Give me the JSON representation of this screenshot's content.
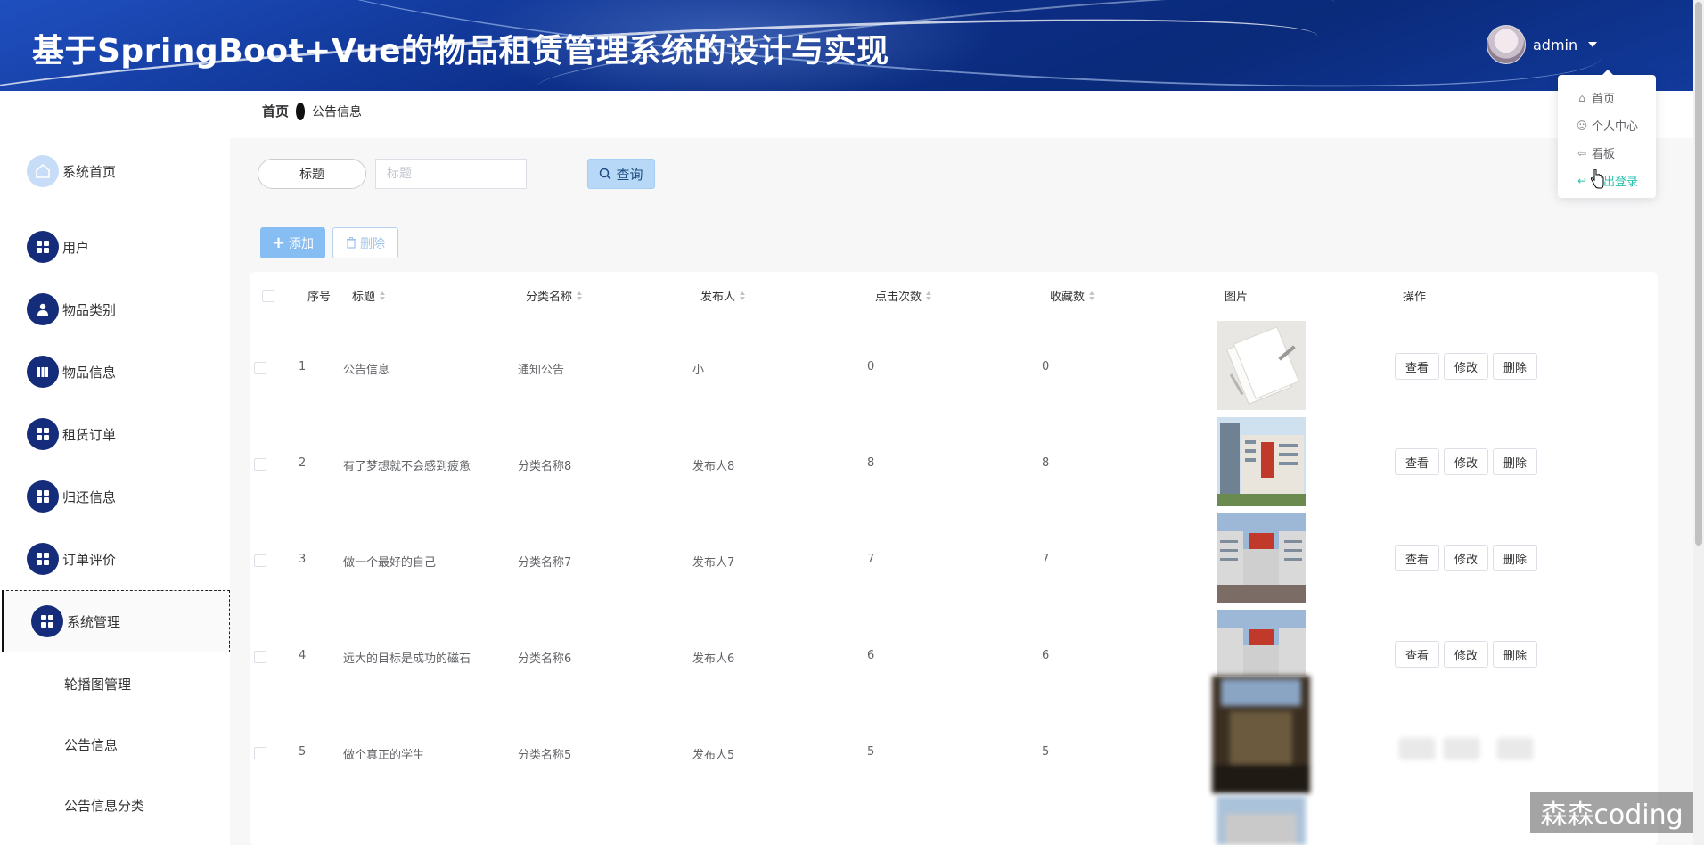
{
  "header": {
    "title": "基于SpringBoot+Vue的物品租赁管理系统的设计与实现",
    "username": "admin"
  },
  "dropdown": {
    "items": [
      {
        "label": "首页",
        "icon": "home-icon"
      },
      {
        "label": "个人中心",
        "icon": "user-icon"
      },
      {
        "label": "看板",
        "icon": "back-arrow-icon"
      },
      {
        "label": "退出登录",
        "icon": "logout-icon"
      }
    ]
  },
  "breadcrumb": {
    "home": "首页",
    "current": "公告信息"
  },
  "sidebar": {
    "items": [
      {
        "label": "系统首页",
        "icon": "home-icon"
      },
      {
        "label": "用户",
        "icon": "grid-icon"
      },
      {
        "label": "物品类别",
        "icon": "user-icon"
      },
      {
        "label": "物品信息",
        "icon": "books-icon"
      },
      {
        "label": "租赁订单",
        "icon": "grid-icon"
      },
      {
        "label": "归还信息",
        "icon": "grid-icon"
      },
      {
        "label": "订单评价",
        "icon": "grid-icon"
      },
      {
        "label": "系统管理",
        "icon": "grid-icon"
      }
    ],
    "subitems": [
      "轮播图管理",
      "公告信息",
      "公告信息分类"
    ]
  },
  "search": {
    "label": "标题",
    "placeholder": "标题",
    "query_label": "查询"
  },
  "actions": {
    "add_label": "添加",
    "delete_label": "删除"
  },
  "table": {
    "columns": [
      "序号",
      "标题",
      "分类名称",
      "发布人",
      "点击次数",
      "收藏数",
      "图片",
      "操作"
    ],
    "rows": [
      {
        "no": "1",
        "title": "公告信息",
        "category": "通知公告",
        "publisher": "小",
        "clicks": "0",
        "favs": "0"
      },
      {
        "no": "2",
        "title": "有了梦想就不会感到疲惫",
        "category": "分类名称8",
        "publisher": "发布人8",
        "clicks": "8",
        "favs": "8"
      },
      {
        "no": "3",
        "title": "做一个最好的自己",
        "category": "分类名称7",
        "publisher": "发布人7",
        "clicks": "7",
        "favs": "7"
      },
      {
        "no": "4",
        "title": "远大的目标是成功的磁石",
        "category": "分类名称6",
        "publisher": "发布人6",
        "clicks": "6",
        "favs": "6"
      },
      {
        "no": "5",
        "title": "做个真正的学生",
        "category": "分类名称5",
        "publisher": "发布人5",
        "clicks": "5",
        "favs": "5"
      }
    ],
    "ops": {
      "view": "查看",
      "edit": "修改",
      "delete": "删除"
    }
  },
  "watermark": "森森coding"
}
